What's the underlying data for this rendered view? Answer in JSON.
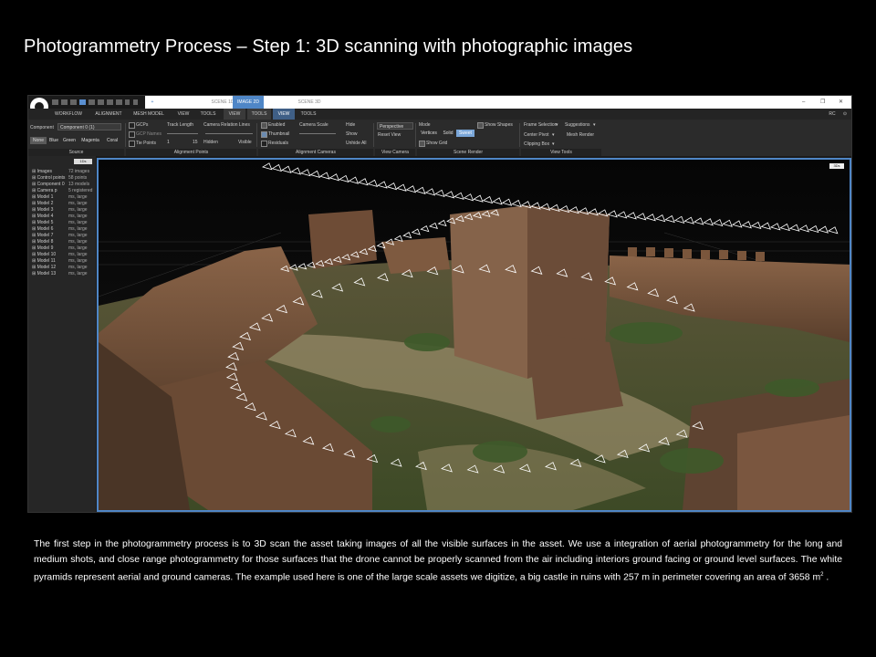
{
  "slide": {
    "title": "Photogrammetry Process – Step 1: 3D scanning with photographic images",
    "caption_main": "The first step in the photogrammetry process is to 3D scan the asset taking images of all the visible surfaces in the asset. We use a integration of aerial photogrammetry for the long and medium shots, and close range photogrammetry for those surfaces that the drone cannot be properly scanned from the air including interiors ground facing or ground level surfaces. The white pyramids represent aerial and ground cameras. The example used here is one of the large scale assets we digitize, a big castle in ruins with 257 m in perimeter covering an area of 3658 m",
    "caption_sup": "2",
    "caption_end": " ."
  },
  "app": {
    "view_tabs": [
      "SCENE 1D",
      "IMAGE 2D",
      "SCENE 3D"
    ],
    "window_controls": [
      "–",
      "❐",
      "✕"
    ],
    "ribbon_tabs": [
      "WORKFLOW",
      "ALIGNMENT",
      "MESH MODEL",
      "VIEW",
      "TOOLS",
      "VIEW",
      "TOOLS",
      "VIEW",
      "TOOLS"
    ],
    "ribbon_right": "RC",
    "component_label": "Component",
    "component_value": "Component 0 (1)",
    "colors": [
      "None",
      "Blue",
      "Green",
      "Magenta",
      "Coral"
    ],
    "alignment_points": {
      "gcps": "GCPs",
      "gcp_names": "GCP Names",
      "tie_points": "Tie Points",
      "track_length": "Track Length",
      "track_min": "1",
      "track_max": "15",
      "relation_lines": "Camera Relation Lines",
      "hidden": "Hidden",
      "visible": "Visible"
    },
    "alignment_cameras": {
      "enabled": "Enabled",
      "thumbnail": "Thumbnail",
      "residuals": "Residuals",
      "camera_scale": "Camera Scale",
      "hide": "Hide",
      "show": "Show",
      "unhide_all": "Unhide All"
    },
    "view_camera": {
      "projection": "Perspective",
      "reset": "Reset View"
    },
    "scene_render": {
      "mode": "Mode",
      "show_shapes": "Show Shapes",
      "modes": [
        "Vertices",
        "Solid",
        "Sweet"
      ],
      "show_grid": "Show Grid"
    },
    "view_tools": {
      "frame_selection": "Frame Selection",
      "suggestions": "Suggestions",
      "center_pivot": "Center Pivot",
      "mesh_render": "Mesh Render",
      "clipping_box": "Clipping Box"
    },
    "groups": [
      "Source",
      "Alignment Points",
      "Alignment Cameras",
      "View Camera",
      "Scene Render",
      "View Tools"
    ],
    "sidebar_badge": "1Ds",
    "viewport_badge": "3Ds",
    "tree": [
      {
        "label": "Images",
        "value": "72 images"
      },
      {
        "label": "Control points",
        "value": "58 points"
      },
      {
        "label": "Component 0",
        "value": "13 models"
      },
      {
        "label": "Camera p",
        "value": "5 registered"
      },
      {
        "label": "Model 1",
        "value": "ms, large"
      },
      {
        "label": "Model 2",
        "value": "ms, large"
      },
      {
        "label": "Model 3",
        "value": "ms, large"
      },
      {
        "label": "Model 4",
        "value": "ms, large"
      },
      {
        "label": "Model 5",
        "value": "ms, large"
      },
      {
        "label": "Model 6",
        "value": "ms, large"
      },
      {
        "label": "Model 7",
        "value": "ms, large"
      },
      {
        "label": "Model 8",
        "value": "ms, large"
      },
      {
        "label": "Model 9",
        "value": "ms, large"
      },
      {
        "label": "Model 10",
        "value": "ms, large"
      },
      {
        "label": "Model 11",
        "value": "ms, large"
      },
      {
        "label": "Model 12",
        "value": "ms, large"
      },
      {
        "label": "Model 13",
        "value": "ms, large"
      }
    ]
  }
}
